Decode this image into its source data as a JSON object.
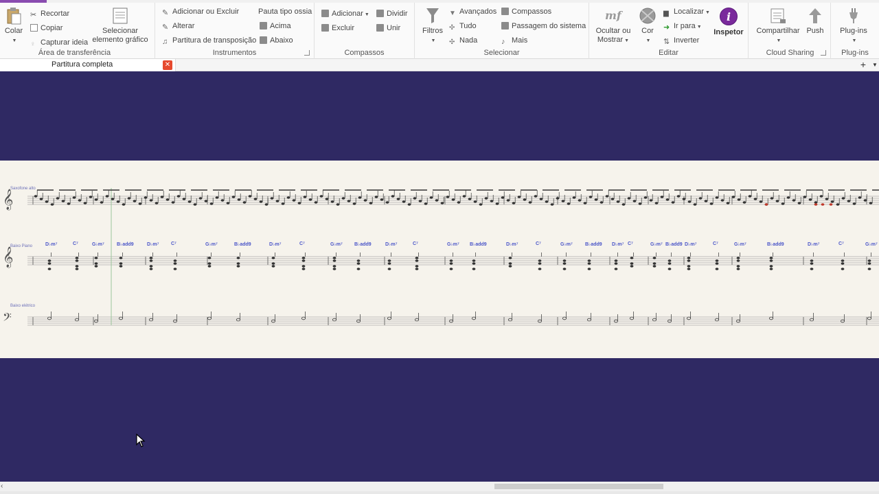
{
  "ribbon": {
    "clipboard": {
      "label": "Área de transferência",
      "paste": "Colar",
      "cut": "Recortar",
      "copy": "Copiar",
      "capture_idea": "Capturar ideia",
      "select_graphic_line1": "Selecionar",
      "select_graphic_line2": "elemento gráfico"
    },
    "instruments": {
      "label": "Instrumentos",
      "add_remove": "Adicionar ou Excluir",
      "change": "Alterar",
      "transposing_score": "Partitura de transposição",
      "ossia": "Pauta tipo ossia",
      "above": "Acima",
      "below": "Abaixo"
    },
    "bars": {
      "label": "Compassos",
      "add": "Adicionar",
      "delete": "Excluir",
      "split": "Dividir",
      "join": "Unir"
    },
    "select": {
      "label": "Selecionar",
      "filters": "Filtros",
      "advanced": "Avançados",
      "all": "Tudo",
      "none": "Nada",
      "bars": "Compassos",
      "system_passage": "Passagem do sistema",
      "more": "Mais"
    },
    "edit": {
      "label": "Editar",
      "hide_show_line1": "Ocultar ou",
      "hide_show_line2": "Mostrar",
      "color": "Cor",
      "find": "Localizar",
      "goto": "Ir para",
      "flip": "Inverter",
      "inspector": "Inspetor"
    },
    "cloud": {
      "label": "Cloud Sharing",
      "share": "Compartilhar",
      "push": "Push"
    },
    "plugins": {
      "label": "Plug-ins",
      "plugins": "Plug-ins"
    }
  },
  "tabs": {
    "active_label": "Partitura completa"
  },
  "score": {
    "instruments": [
      "Saxofone alto",
      "Baixo Piano",
      "Baixo elétrico"
    ],
    "chords": [
      "D♭m⁷",
      "C⁷",
      "G♭m⁷",
      "B♭add9"
    ]
  },
  "colors": {
    "background": "#2f2963",
    "paper": "#f6f3ec",
    "chord_symbol": "#4a55c8",
    "accent": "#8a4cb0"
  }
}
